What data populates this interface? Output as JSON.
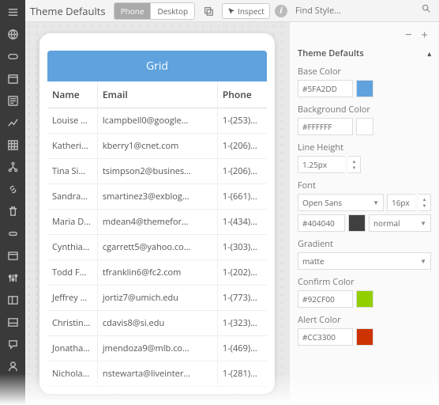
{
  "topbar": {
    "title": "Theme Defaults",
    "seg_phone": "Phone",
    "seg_desktop": "Desktop",
    "inspect": "Inspect",
    "search_placeholder": "Find Style..."
  },
  "grid": {
    "title": "Grid",
    "cols": {
      "name": "Name",
      "email": "Email",
      "phone": "Phone"
    },
    "rows": [
      {
        "name": "Louise ...",
        "email": "lcampbell0@google...",
        "phone": "1-(253)..."
      },
      {
        "name": "Katheri...",
        "email": "kberry1@cnet.com",
        "phone": "1-(206)..."
      },
      {
        "name": "Tina Si...",
        "email": "tsimpson2@busines...",
        "phone": "1-(206)..."
      },
      {
        "name": "Sandra...",
        "email": "smartinez3@exblog...",
        "phone": "1-(661)..."
      },
      {
        "name": "Maria D...",
        "email": "mdean4@themefor...",
        "phone": "1-(434)..."
      },
      {
        "name": "Cynthia...",
        "email": "cgarrett5@yahoo.co...",
        "phone": "1-(303)..."
      },
      {
        "name": "Todd F...",
        "email": "tfranklin6@fc2.com",
        "phone": "1-(202)..."
      },
      {
        "name": "Jeffrey ...",
        "email": "jortiz7@umich.edu",
        "phone": "1-(773)..."
      },
      {
        "name": "Christin...",
        "email": "cdavis8@si.edu",
        "phone": "1-(323)..."
      },
      {
        "name": "Jonatha...",
        "email": "jmendoza9@mlb.co...",
        "phone": "1-(469)..."
      },
      {
        "name": "Nichola...",
        "email": "nstewarta@liveinter...",
        "phone": "1-(281)..."
      }
    ]
  },
  "panel": {
    "section": "Theme Defaults",
    "base_color_lbl": "Base Color",
    "base_color": "#5FA2DD",
    "bg_color_lbl": "Background Color",
    "bg_color": "#FFFFFF",
    "line_height_lbl": "Line Height",
    "line_height": "1.25px",
    "font_lbl": "Font",
    "font_family": "Open Sans",
    "font_size": "16px",
    "font_color": "#404040",
    "font_weight": "normal",
    "gradient_lbl": "Gradient",
    "gradient": "matte",
    "confirm_lbl": "Confirm Color",
    "confirm_color": "#92CF00",
    "alert_lbl": "Alert Color",
    "alert_color": "#CC3300"
  }
}
